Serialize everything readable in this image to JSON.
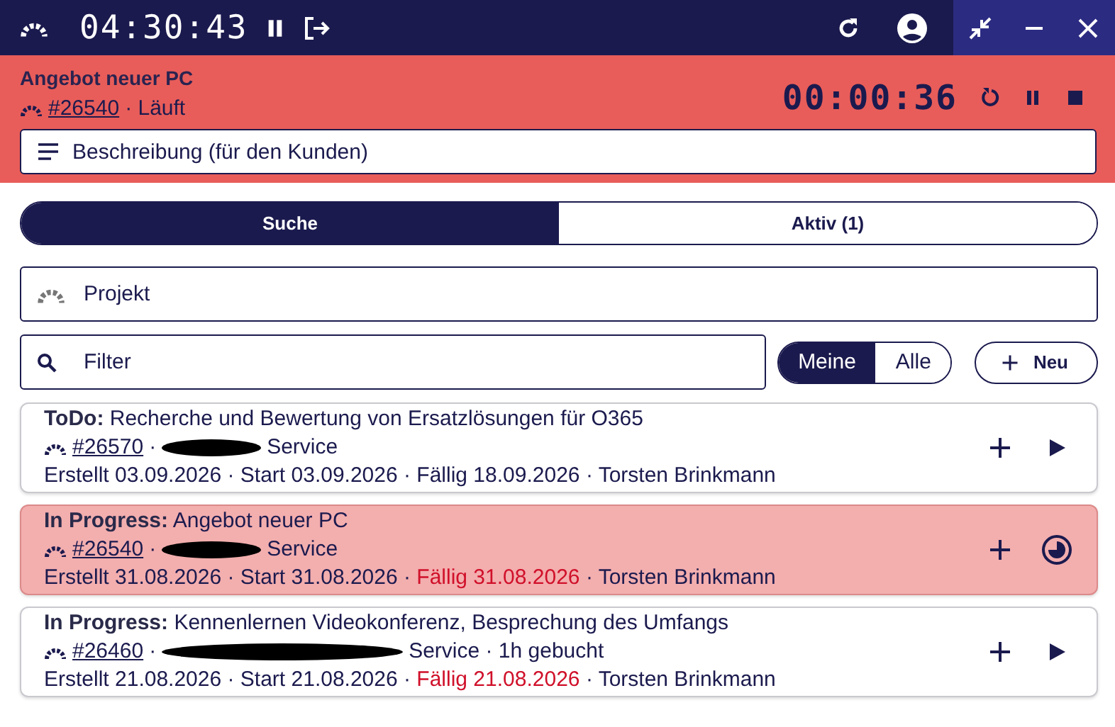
{
  "top_bar": {
    "clock": "04:30:43"
  },
  "current": {
    "title": "Angebot neuer PC",
    "number": "#26540",
    "separator": "·",
    "status": "Läuft",
    "timer": "00:00:36",
    "description_placeholder": "Beschreibung (für den Kunden)"
  },
  "tabs": [
    {
      "label": "Suche",
      "selected": true
    },
    {
      "label": "Aktiv (1)",
      "selected": false
    }
  ],
  "project_field": {
    "placeholder": "Projekt"
  },
  "filter_field": {
    "placeholder": "Filter"
  },
  "scope": [
    {
      "label": "Meine",
      "selected": true
    },
    {
      "label": "Alle",
      "selected": false
    }
  ],
  "new_button": {
    "label": "Neu"
  },
  "separator": "·",
  "tasks": [
    {
      "status": "ToDo:",
      "title": "Recherche und Bewertung von Ersatzlösungen für O365",
      "number": "#26570",
      "customer": "Service",
      "redacted": true,
      "dates": "Erstellt 03.09.2026 · Start 03.09.2026 ·",
      "due": "Fällig 18.09.2026",
      "overdue": false,
      "person": "· Torsten Brinkmann",
      "active": false,
      "kind": "play"
    },
    {
      "status": "In Progress:",
      "title": "Angebot neuer PC",
      "number": "#26540",
      "customer": "Service",
      "redacted": true,
      "dates": "Erstellt 31.08.2026 · Start 31.08.2026 ·",
      "due": "Fällig 31.08.2026",
      "overdue": true,
      "person": "· Torsten Brinkmann",
      "active": true,
      "kind": "timer"
    },
    {
      "status": "In Progress:",
      "title": "Kennenlernen Videokonferenz, Besprechung des Umfangs",
      "number": "#26460",
      "customer": "Service · 1h gebucht",
      "redacted": true,
      "dates": "Erstellt 21.08.2026 · Start 21.08.2026 ·",
      "due": "Fällig 21.08.2026",
      "overdue": true,
      "person": "· Torsten Brinkmann",
      "active": false,
      "kind": "play"
    }
  ]
}
